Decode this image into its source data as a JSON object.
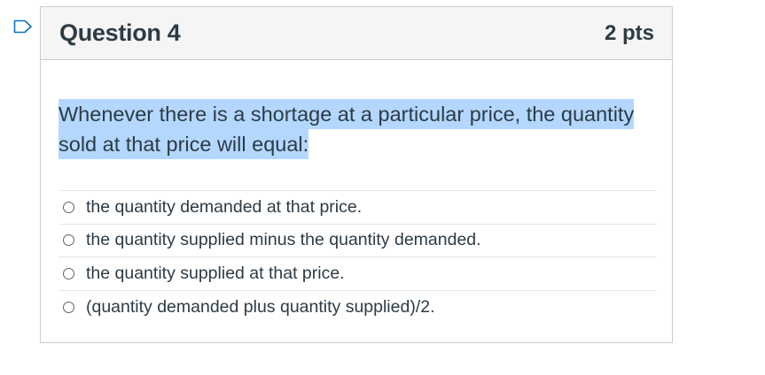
{
  "question": {
    "title": "Question 4",
    "points": "2 pts",
    "text": "Whenever there is a shortage at a particular price, the quantity sold at that price will equal:",
    "answers": [
      {
        "label": "the quantity demanded at that price."
      },
      {
        "label": "the quantity supplied minus the quantity demanded."
      },
      {
        "label": "the quantity supplied at that price."
      },
      {
        "label": "(quantity demanded plus quantity supplied)/2."
      }
    ]
  },
  "icons": {
    "flag": "flag-icon",
    "radio": "radio-unselected-icon"
  },
  "colors": {
    "text": "#2d3b45",
    "border": "#c7cdd1",
    "header_bg": "#f5f5f5",
    "selection_highlight": "#b3d7ff",
    "flag": "#0b74c2"
  }
}
